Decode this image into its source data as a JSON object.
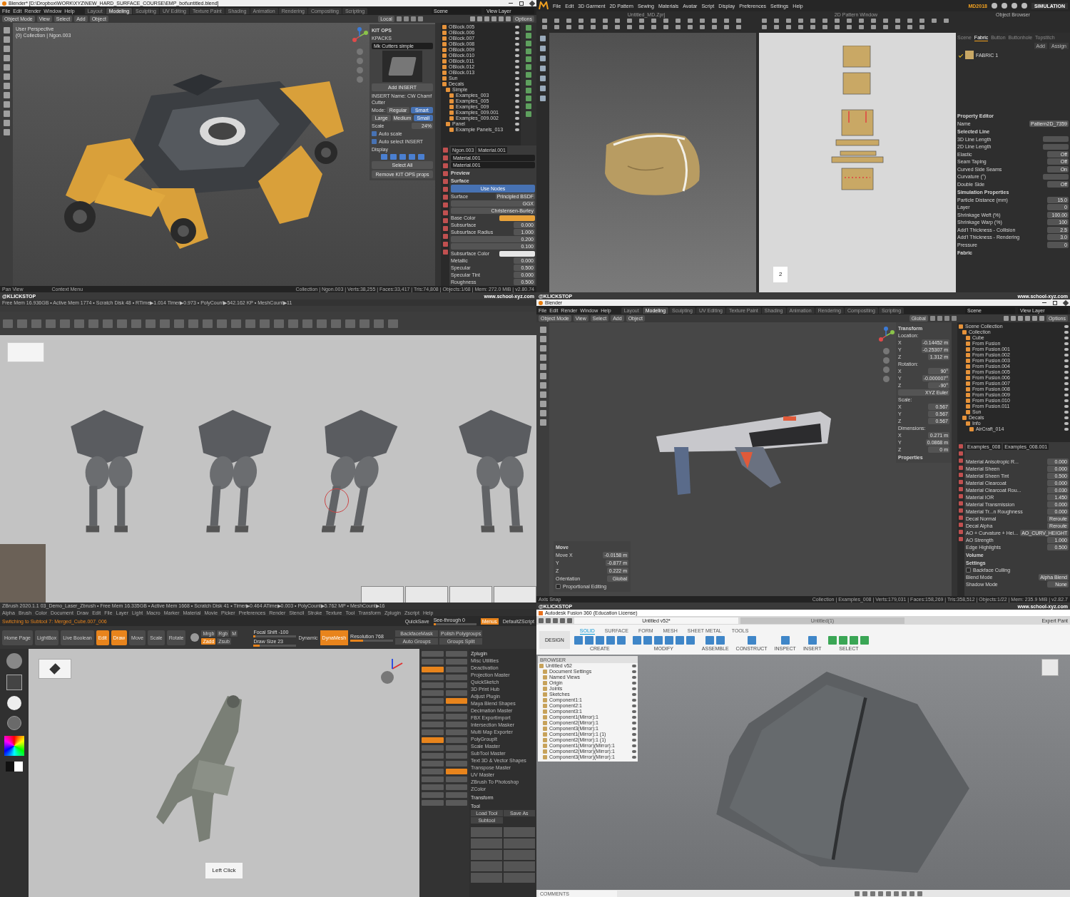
{
  "panels": [
    {
      "kind": "blender",
      "title": "Blender* [D:\\Dropbox\\WORK\\XYZ\\NEW_HARD_SURFACE_COURSE\\EMP_bot\\untitled.blend]",
      "menus": [
        "File",
        "Edit",
        "Render",
        "Window",
        "Help"
      ],
      "workspaces": [
        {
          "label": "Layout",
          "selected": false
        },
        {
          "label": "Modeling",
          "selected": true
        },
        {
          "label": "Sculpting",
          "selected": false
        },
        {
          "label": "UV Editing",
          "selected": false
        },
        {
          "label": "Texture Paint",
          "selected": false
        },
        {
          "label": "Shading",
          "selected": false
        },
        {
          "label": "Animation",
          "selected": false
        },
        {
          "label": "Rendering",
          "selected": false
        },
        {
          "label": "Compositing",
          "selected": false
        },
        {
          "label": "Scripting",
          "selected": false
        }
      ],
      "scene": "Scene",
      "view_layer": "View Layer",
      "mode": "Object Mode",
      "header_menus": [
        "View",
        "Select",
        "Add",
        "Object"
      ],
      "orientation": "Local",
      "options": "Options",
      "viewport_info": [
        "User Perspective",
        "(0) Collection | Ngon.003"
      ],
      "side_panel": [
        {
          "kind": "header",
          "label": "KIT OPS"
        },
        {
          "kind": "item",
          "label": "KPACKS"
        },
        {
          "kind": "field",
          "label": "Mk Cutters simple"
        },
        {
          "kind": "thumbnail"
        },
        {
          "kind": "button",
          "label": "Add INSERT"
        },
        {
          "kind": "text",
          "label": "INSERT Name: CW Chamf Cutter"
        },
        {
          "kind": "buttons",
          "label": "Mode:",
          "options": [
            {
              "label": "Regular",
              "selected": false
            },
            {
              "label": "Smart",
              "selected": true
            }
          ]
        },
        {
          "kind": "buttons",
          "options": [
            {
              "label": "Large",
              "selected": false
            },
            {
              "label": "Medium",
              "selected": false
            },
            {
              "label": "Small",
              "selected": true
            }
          ]
        },
        {
          "kind": "value",
          "label": "Scale",
          "value": "24%"
        },
        {
          "kind": "check",
          "label": "Auto scale",
          "checked": true
        },
        {
          "kind": "check",
          "label": "Auto select INSERT",
          "checked": true
        },
        {
          "kind": "text",
          "label": "Display"
        },
        {
          "kind": "iconrow"
        },
        {
          "kind": "button",
          "label": "Select All"
        },
        {
          "kind": "button",
          "label": "Remove KIT OPS props"
        }
      ],
      "outliner": [
        {
          "label": "OBlock.005"
        },
        {
          "label": "OBlock.006"
        },
        {
          "label": "OBlock.007"
        },
        {
          "label": "OBlock.008"
        },
        {
          "label": "OBlock.009"
        },
        {
          "label": "OBlock.010"
        },
        {
          "label": "OBlock.011"
        },
        {
          "label": "OBlock.012"
        },
        {
          "label": "OBlock.013"
        },
        {
          "label": "Sun"
        },
        {
          "label": "Decals",
          "children": [
            {
              "label": "Simple",
              "children": [
                {
                  "label": "Examples_003"
                },
                {
                  "label": "Examples_005"
                },
                {
                  "label": "Examples_009"
                },
                {
                  "label": "Examples_009.001"
                },
                {
                  "label": "Examples_009.002"
                }
              ]
            },
            {
              "label": "Panel",
              "children": [
                {
                  "label": "Example Panels_013"
                }
              ]
            }
          ]
        }
      ],
      "object_tabs": [
        "Ngon.003",
        "Material.001"
      ],
      "properties": [
        {
          "kind": "field",
          "label": "Material.001"
        },
        {
          "kind": "field",
          "label": "Material.001"
        },
        {
          "kind": "header",
          "label": "Preview"
        },
        {
          "kind": "header",
          "label": "Surface"
        },
        {
          "kind": "primary",
          "label": "Use Nodes"
        },
        {
          "kind": "value",
          "label": "Surface",
          "value": "Principled BSDF"
        },
        {
          "kind": "value",
          "value": "GGX"
        },
        {
          "kind": "value",
          "value": "Christensen-Burley"
        },
        {
          "kind": "color",
          "label": "Base Color",
          "color": "#e8a23a"
        },
        {
          "kind": "value",
          "label": "Subsurface",
          "value": "0.000"
        },
        {
          "kind": "value",
          "label": "Subsurface Radius",
          "value": "1.000"
        },
        {
          "kind": "value",
          "value": "0.200"
        },
        {
          "kind": "value",
          "value": "0.100"
        },
        {
          "kind": "color",
          "label": "Subsurface Color",
          "color": "#e6e6e6"
        },
        {
          "kind": "value",
          "label": "Metallic",
          "value": "0.000"
        },
        {
          "kind": "value",
          "label": "Specular",
          "value": "0.500"
        },
        {
          "kind": "value",
          "label": "Specular Tint",
          "value": "0.000"
        },
        {
          "kind": "value",
          "label": "Roughness",
          "value": "0.500"
        }
      ],
      "status_left": [
        "Pan View",
        "Context Menu"
      ],
      "status_right": "Collection | Ngon.003 | Verts:38,255 | Faces:33,417 | Tris:74,808 | Objects:1/68 | Mem: 272.0 MiB | v2.80.74"
    },
    {
      "kind": "marvelous",
      "menus": [
        "File",
        "Edit",
        "3D Garment",
        "2D Pattern",
        "Sewing",
        "Materials",
        "Avatar",
        "Script",
        "Display",
        "Preferences",
        "Settings",
        "Help"
      ],
      "version": "MD2018",
      "mode": "SIMULATION",
      "window_3d": "Untitled_MD.Zprj",
      "window_2d": "2D Pattern Window",
      "page": "2",
      "browser_title": "Object Browser",
      "browser_tabs": [
        {
          "label": "Scene",
          "selected": false
        },
        {
          "label": "Fabric",
          "selected": true
        },
        {
          "label": "Button",
          "selected": false
        },
        {
          "label": "Buttonhole",
          "selected": false
        },
        {
          "label": "Topstitch",
          "selected": false
        }
      ],
      "browser_buttons": [
        "Add",
        "Assign"
      ],
      "fabric": "FABRIC 1",
      "properties": [
        {
          "kind": "header",
          "label": "Property Editor"
        },
        {
          "kind": "value",
          "label": "Name",
          "value": "Pattern2D_7359"
        },
        {
          "kind": "header",
          "label": "Selected Line"
        },
        {
          "kind": "value",
          "label": "3D Line Length"
        },
        {
          "kind": "value",
          "label": "2D Line Length"
        },
        {
          "kind": "value",
          "label": "Elastic",
          "value": "Off"
        },
        {
          "kind": "value",
          "label": "Seam Taping",
          "value": "Off"
        },
        {
          "kind": "value",
          "label": "Curved Side Seams",
          "value": "On"
        },
        {
          "kind": "value",
          "label": "Curvature (°)"
        },
        {
          "kind": "value",
          "label": "Double Side",
          "value": "Off"
        },
        {
          "kind": "header",
          "label": "Simulation Properties"
        },
        {
          "kind": "value",
          "label": "Particle Distance (mm)",
          "value": "15.0"
        },
        {
          "kind": "value",
          "label": "Layer",
          "value": "0"
        },
        {
          "kind": "value",
          "label": "Shrinkage Weft (%)",
          "value": "100.00"
        },
        {
          "kind": "value",
          "label": "Shrinkage Warp (%)",
          "value": "100"
        },
        {
          "kind": "value",
          "label": "Add'l Thickness - Collision",
          "value": "2.5"
        },
        {
          "kind": "value",
          "label": "Add'l Thickness - Rendering",
          "value": "3.0"
        },
        {
          "kind": "value",
          "label": "Pressure",
          "value": "0"
        },
        {
          "kind": "header",
          "label": "Fabric"
        }
      ]
    },
    {
      "kind": "zbrush_views",
      "strip": {
        "left": "@KLICKSTOP",
        "right": "www.school-xyz.com"
      },
      "info": "Free Mem 16.936GB • Active Mem 1774 • Scratch Disk 48 • RTime▶1.014 Timer▶0.973 • PolyCount▶542.162 KP • MeshCount▶11"
    },
    {
      "kind": "blender2",
      "strip": {
        "left": "@KLICKSTOP",
        "right": "www.school-xyz.com"
      },
      "title": "Blender",
      "menus": [
        "File",
        "Edit",
        "Render",
        "Window",
        "Help"
      ],
      "workspaces": [
        {
          "label": "Layout",
          "selected": false
        },
        {
          "label": "Modeling",
          "selected": true
        },
        {
          "label": "Sculpting",
          "selected": false
        },
        {
          "label": "UV Editing",
          "selected": false
        },
        {
          "label": "Texture Paint",
          "selected": false
        },
        {
          "label": "Shading",
          "selected": false
        },
        {
          "label": "Animation",
          "selected": false
        },
        {
          "label": "Rendering",
          "selected": false
        },
        {
          "label": "Compositing",
          "selected": false
        },
        {
          "label": "Scripting",
          "selected": false
        }
      ],
      "scene": "Scene",
      "view_layer": "View Layer",
      "mode": "Object Mode",
      "header_menus": [
        "View",
        "Select",
        "Add",
        "Object"
      ],
      "orientation": "Global",
      "options": "Options",
      "side_panel": [
        {
          "kind": "header",
          "label": "Transform"
        },
        {
          "kind": "text",
          "label": "Location:"
        },
        {
          "kind": "value",
          "label": "X",
          "value": "-0.14452 m"
        },
        {
          "kind": "value",
          "label": "Y",
          "value": "-0.25307 m"
        },
        {
          "kind": "value",
          "label": "Z",
          "value": "1.312 m"
        },
        {
          "kind": "text",
          "label": "Rotation:"
        },
        {
          "kind": "value",
          "label": "X",
          "value": "90°"
        },
        {
          "kind": "value",
          "label": "Y",
          "value": "-0.000007°"
        },
        {
          "kind": "value",
          "label": "Z",
          "value": "-90°"
        },
        {
          "kind": "value",
          "value": "XYZ Euler"
        },
        {
          "kind": "text",
          "label": "Scale:"
        },
        {
          "kind": "value",
          "label": "X",
          "value": "0.567"
        },
        {
          "kind": "value",
          "label": "Y",
          "value": "0.567"
        },
        {
          "kind": "value",
          "label": "Z",
          "value": "0.567"
        },
        {
          "kind": "text",
          "label": "Dimensions:"
        },
        {
          "kind": "value",
          "label": "X",
          "value": "0.271 m"
        },
        {
          "kind": "value",
          "label": "Y",
          "value": "0.0868 m"
        },
        {
          "kind": "value",
          "label": "Z",
          "value": "0 m"
        },
        {
          "kind": "header",
          "label": "Properties"
        }
      ],
      "operator_panel": [
        {
          "kind": "header",
          "label": "Move"
        },
        {
          "kind": "value",
          "label": "Move X",
          "value": "-0.0158 m"
        },
        {
          "kind": "value",
          "label": "Y",
          "value": "-0.877 m"
        },
        {
          "kind": "value",
          "label": "Z",
          "value": "0.222 m"
        },
        {
          "kind": "value",
          "label": "Orientation",
          "value": "Global"
        },
        {
          "kind": "check",
          "label": "Proportional Editing",
          "checked": false
        }
      ],
      "outliner": [
        {
          "label": "Scene Collection",
          "children": [
            {
              "label": "Collection",
              "children": [
                {
                  "label": "Cube"
                },
                {
                  "label": "From Fusion"
                },
                {
                  "label": "From Fusion.001"
                },
                {
                  "label": "From Fusion.002"
                },
                {
                  "label": "From Fusion.003"
                },
                {
                  "label": "From Fusion.004"
                },
                {
                  "label": "From Fusion.005"
                },
                {
                  "label": "From Fusion.006"
                },
                {
                  "label": "From Fusion.007"
                },
                {
                  "label": "From Fusion.008"
                },
                {
                  "label": "From Fusion.009"
                },
                {
                  "label": "From Fusion.010"
                },
                {
                  "label": "From Fusion.011"
                },
                {
                  "label": "Sun"
                }
              ]
            },
            {
              "label": "Decals",
              "children": [
                {
                  "label": "Info",
                  "children": [
                    {
                      "label": "AirCraft_014"
                    }
                  ]
                }
              ]
            }
          ]
        }
      ],
      "object_tabs": [
        "Examples_008",
        "Examples_008.001"
      ],
      "properties": [
        {
          "kind": "value",
          "label": "Material Anisotropic R...",
          "value": "0.000"
        },
        {
          "kind": "value",
          "label": "Material Sheen",
          "value": "0.000"
        },
        {
          "kind": "value",
          "label": "Material Sheen Tint",
          "value": "0.500"
        },
        {
          "kind": "value",
          "label": "Material Clearcoat",
          "value": "0.000"
        },
        {
          "kind": "value",
          "label": "Material Clearcoat Rou...",
          "value": "0.030"
        },
        {
          "kind": "value",
          "label": "Material IOR",
          "value": "1.450"
        },
        {
          "kind": "value",
          "label": "Material Transmission",
          "value": "0.000"
        },
        {
          "kind": "value",
          "label": "Material Tr...n Roughness",
          "value": "0.000"
        },
        {
          "kind": "value",
          "label": "Decal Normal",
          "value": "Reroute"
        },
        {
          "kind": "value",
          "label": "Decal Alpha",
          "value": "Reroute"
        },
        {
          "kind": "value",
          "label": "AO + Curvature + Hei...",
          "value": "AO_CURV_HEIGHT"
        },
        {
          "kind": "value",
          "label": "AO Strength",
          "value": "1.000"
        },
        {
          "kind": "value",
          "label": "Edge Highlights",
          "value": "0.500"
        },
        {
          "kind": "header",
          "label": "Volume"
        },
        {
          "kind": "header",
          "label": "Settings"
        },
        {
          "kind": "check",
          "label": "Backface Culling",
          "checked": false
        },
        {
          "kind": "value",
          "label": "Blend Mode",
          "value": "Alpha Blend"
        },
        {
          "kind": "value",
          "label": "Shadow Mode",
          "value": "None"
        }
      ],
      "status_left": [
        "Axis Snap"
      ],
      "status_right": "Collection | Examples_008 | Verts:179,031 | Faces:158,269 | Tris:358,512 | Objects:1/22 | Mem: 235.9 MiB | v2.82.7"
    },
    {
      "kind": "zbrush",
      "info": "ZBrush 2020.1.1   03_Demo_Laser_Zbrush   • Free Mem 16.335GB • Active Mem 1668 • Scratch Disk 41 • Timer▶0.464 ATime▶0.003 • PolyCount▶5.762 MP • MeshCount▶16",
      "menus": [
        "Alpha",
        "Brush",
        "Color",
        "Document",
        "Draw",
        "Edit",
        "File",
        "Layer",
        "Light",
        "Macro",
        "Marker",
        "Material",
        "Movie",
        "Picker",
        "Preferences",
        "Render",
        "Stencil",
        "Stroke",
        "Texture",
        "Tool",
        "Transform",
        "Zplugin",
        "Zscript",
        "Help"
      ],
      "quicksave": "QuickSave",
      "see_through": {
        "label": "See-through 0",
        "level": 0.05
      },
      "menus_button": "Menus",
      "script": "DefaultZScript",
      "notice": "Switching to Subtool 7: Merged_Cube.007_006",
      "tools": [
        {
          "label": "Home Page",
          "selected": false
        },
        {
          "label": "LightBox",
          "selected": false
        },
        {
          "label": "Live Boolean",
          "selected": false
        },
        {
          "label": "Edit",
          "selected": true
        },
        {
          "label": "Draw",
          "selected": true
        },
        {
          "label": "Move",
          "selected": false
        },
        {
          "label": "Scale",
          "selected": false
        },
        {
          "label": "Rotate",
          "selected": false
        }
      ],
      "modes": [
        {
          "label": "Mrgb",
          "selected": false
        },
        {
          "label": "Rgb",
          "selected": false
        },
        {
          "label": "M",
          "selected": false
        },
        {
          "label": "Zadd",
          "selected": true
        },
        {
          "label": "Zsub",
          "selected": false
        }
      ],
      "sliders": [
        {
          "label": "Focal Shift -100",
          "level": 0.05
        },
        {
          "label": "Draw Size 23",
          "level": 0.15
        }
      ],
      "dynamic": "Dynamic",
      "dynamesh": "DynaMesh",
      "resolution": {
        "label": "Resolution 768",
        "level": 0.3
      },
      "groups": [
        "BackfaceMask",
        "Polish Polygroups",
        "Auto Groups",
        "Groups Split"
      ],
      "plugin_title": "Zplugin",
      "plugins": [
        "Misc Utilities",
        "Deactivation",
        "Projection Master",
        "QuickSketch",
        "3D Print Hub",
        "Adjust Plugin",
        "Maya Blend Shapes",
        "Decimation Master",
        "FBX ExportImport",
        "Intersection Masker",
        "Multi Map Exporter",
        "PolyGroupIt",
        "Scale Master",
        "SubTool Master",
        "Text 3D & Vector Shapes",
        "Transpose Master",
        "UV Master",
        "ZBrush To Photoshop",
        "ZColor"
      ],
      "sections": [
        "Transform",
        "Tool"
      ],
      "tool_buttons": [
        "Load Tool",
        "Save As",
        "Subtool"
      ],
      "hint": "Left Click"
    },
    {
      "kind": "fusion",
      "strip": {
        "left": "@KLICKSTOP",
        "right": "www.school-xyz.com"
      },
      "title": "Autodesk Fusion 360 (Education License)",
      "documents": [
        {
          "label": "Untitled v52*",
          "selected": true
        },
        {
          "label": "Untitled(1)",
          "selected": false
        }
      ],
      "user": "Expert Pant",
      "workspace": "DESIGN",
      "tabs": [
        {
          "label": "SOLID",
          "selected": true
        },
        {
          "label": "SURFACE",
          "selected": false
        },
        {
          "label": "FORM",
          "selected": false
        },
        {
          "label": "MESH",
          "selected": false
        },
        {
          "label": "SHEET METAL",
          "selected": false
        },
        {
          "label": "TOOLS",
          "selected": false
        }
      ],
      "groups": [
        "CREATE",
        "MODIFY",
        "ASSEMBLE",
        "CONSTRUCT",
        "INSPECT",
        "INSERT",
        "SELECT"
      ],
      "browser": "BROWSER",
      "tree": [
        {
          "label": "Untitled v52",
          "children": [
            {
              "label": "Document Settings"
            },
            {
              "label": "Named Views"
            },
            {
              "label": "Origin"
            },
            {
              "label": "Joints"
            },
            {
              "label": "Sketches"
            },
            {
              "label": "Component1:1"
            },
            {
              "label": "Component2:1"
            },
            {
              "label": "Component3:1"
            },
            {
              "label": "Component1(Mirror):1"
            },
            {
              "label": "Component2(Mirror):1"
            },
            {
              "label": "Component3(Mirror):1"
            },
            {
              "label": "Component1(Mirror):1 (1)"
            },
            {
              "label": "Component2(Mirror):1 (1)"
            },
            {
              "label": "Component1(Mirror)(Mirror):1"
            },
            {
              "label": "Component2(Mirror)(Mirror):1"
            },
            {
              "label": "Component3(Mirror)(Mirror):1"
            }
          ]
        }
      ],
      "comments": "COMMENTS"
    }
  ]
}
